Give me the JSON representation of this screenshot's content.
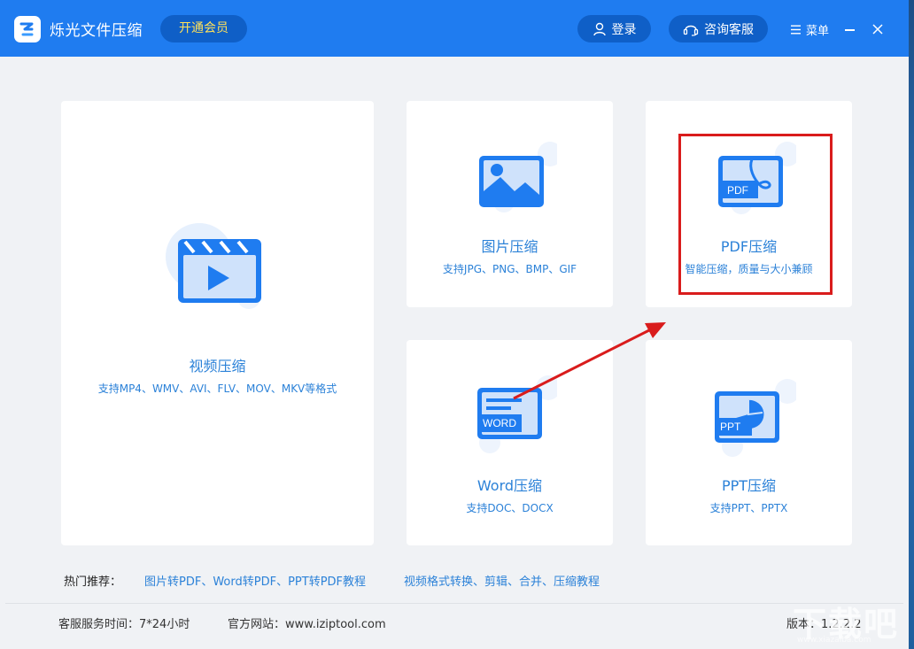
{
  "app": {
    "title": "烁光文件压缩",
    "vip_label": "开通会员",
    "login_label": "登录",
    "service_label": "咨询客服",
    "menu_label": "菜单"
  },
  "cards": {
    "video": {
      "title": "视频压缩",
      "desc": "支持MP4、WMV、AVI、FLV、MOV、MKV等格式"
    },
    "image": {
      "title": "图片压缩",
      "desc": "支持JPG、PNG、BMP、GIF"
    },
    "pdf": {
      "title": "PDF压缩",
      "desc": "智能压缩，质量与大小兼顾",
      "icon_text": "PDF"
    },
    "word": {
      "title": "Word压缩",
      "desc": "支持DOC、DOCX",
      "icon_text": "WORD"
    },
    "ppt": {
      "title": "PPT压缩",
      "desc": "支持PPT、PPTX",
      "icon_text": "PPT"
    }
  },
  "hot": {
    "label": "热门推荐：",
    "links": [
      "图片转PDF、Word转PDF、PPT转PDF教程",
      "视频格式转换、剪辑、合并、压缩教程"
    ]
  },
  "footer": {
    "service_time": "客服服务时间：7*24小时",
    "website": "官方网站：www.iziptool.com",
    "version": "版本：1.2.2.2"
  },
  "watermark": {
    "main": "下载吧",
    "sub": "www.xiazaiba.com"
  },
  "colors": {
    "titlebar": "#1f7cf0",
    "accent": "#2c82d8",
    "vip_text": "#ffe15a",
    "highlight": "#d91c1c"
  },
  "icons": [
    "app-logo-icon",
    "user-icon",
    "headset-icon",
    "hamburger-icon",
    "minimize-icon",
    "close-icon",
    "video-icon",
    "image-icon",
    "pdf-icon",
    "word-icon",
    "ppt-icon"
  ]
}
